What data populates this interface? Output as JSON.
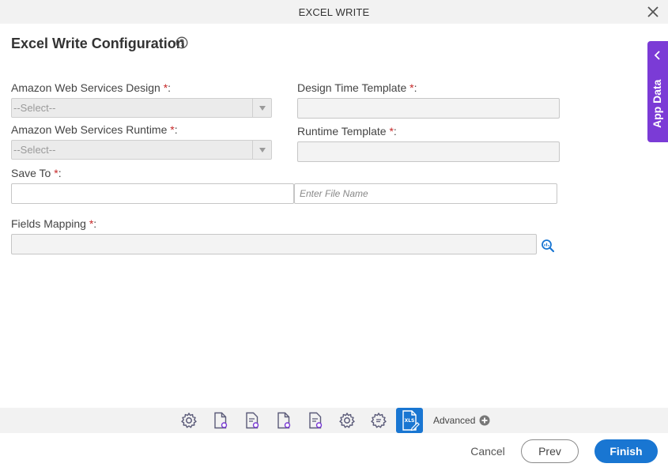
{
  "window": {
    "title": "EXCEL WRITE"
  },
  "page": {
    "heading": "Excel Write Configuration"
  },
  "form": {
    "aws_design": {
      "label": "Amazon Web Services Design",
      "value": "--Select--"
    },
    "aws_runtime": {
      "label": "Amazon Web Services Runtime",
      "value": "--Select--"
    },
    "design_template": {
      "label": "Design Time Template",
      "value": ""
    },
    "runtime_template": {
      "label": "Runtime Template",
      "value": ""
    },
    "save_to": {
      "label": "Save To",
      "value": "",
      "file_name_placeholder": "Enter File Name",
      "file_name_value": ""
    },
    "fields_mapping": {
      "label": "Fields Mapping",
      "value": ""
    },
    "required_marker": "*",
    "label_suffix": ":"
  },
  "side_panel": {
    "label": "App Data"
  },
  "toolbar": {
    "advanced_label": "Advanced",
    "active_icon_text": "XLS"
  },
  "footer": {
    "cancel": "Cancel",
    "prev": "Prev",
    "finish": "Finish"
  },
  "colors": {
    "primary": "#1976d2",
    "app_data": "#7b3bd6",
    "required": "#c62828",
    "icon": "#5a5a78"
  }
}
